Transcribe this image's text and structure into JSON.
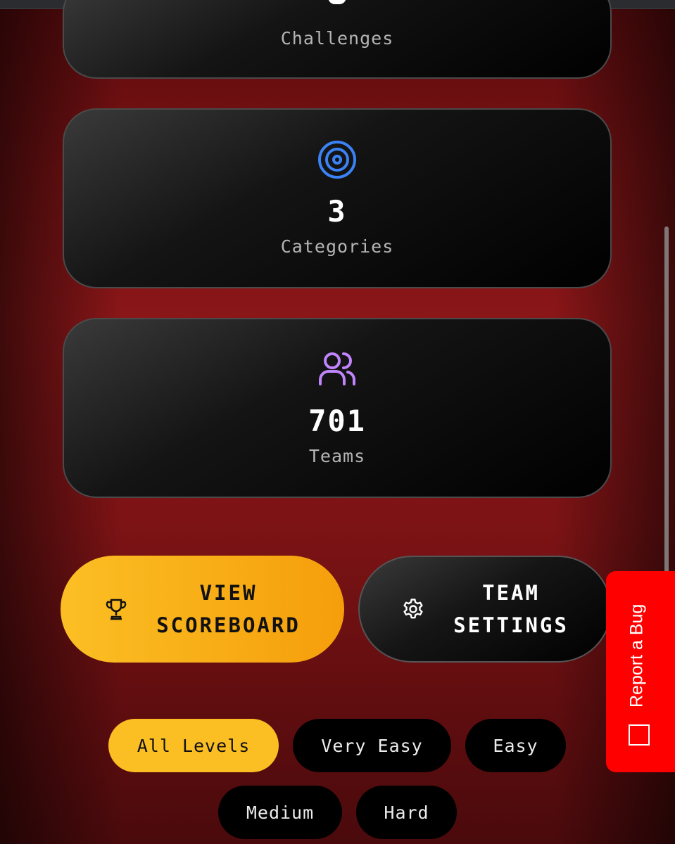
{
  "stats": {
    "challenges": {
      "label": "Challenges"
    },
    "categories": {
      "value": "3",
      "label": "Categories",
      "icon": "target-icon",
      "icon_color": "#3b82f6"
    },
    "teams": {
      "value": "701",
      "label": "Teams",
      "icon": "users-icon",
      "icon_color": "#c084fc"
    }
  },
  "actions": {
    "scoreboard": {
      "line1": "VIEW",
      "line2": "SCOREBOARD",
      "icon": "trophy-icon"
    },
    "settings": {
      "line1": "TEAM",
      "line2": "SETTINGS",
      "icon": "gear-icon"
    }
  },
  "levels": {
    "all": "All Levels",
    "very_easy": "Very Easy",
    "easy": "Easy",
    "medium": "Medium",
    "hard": "Hard",
    "selected": "All Levels"
  },
  "report_bug": {
    "label": "Report a Bug"
  },
  "colors": {
    "accent": "#fbbf24",
    "report": "#ff0000"
  }
}
